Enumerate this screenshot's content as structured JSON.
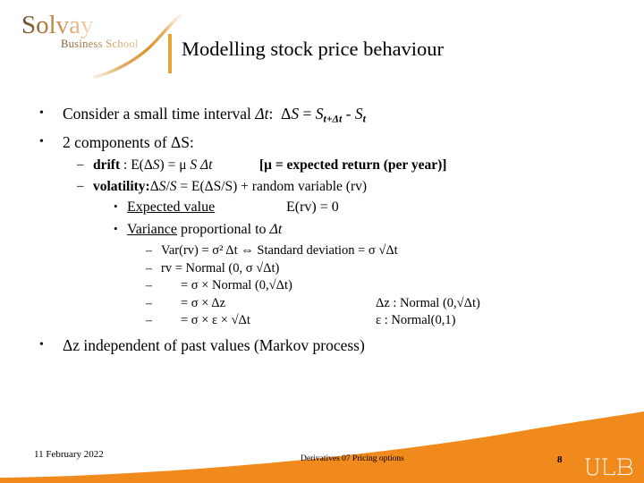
{
  "slide": {
    "logo": {
      "brand": "Solvay",
      "subtitle": "Business School",
      "swoosh_color": "#d99a3c",
      "brand_color_dark": "#6a4a2a",
      "brand_color_light": "#efd9bd"
    },
    "title": {
      "text": "Modelling stock price behaviour",
      "accent_bar_color": "#e3a730"
    },
    "accent_color": "#f08a1c",
    "body": [
      {
        "level": 1,
        "bullet": "•",
        "name": "bullet-consider-interval",
        "segments": [
          {
            "t": "Consider a small time interval "
          },
          {
            "t": "Δt",
            "style": "italic-t"
          },
          {
            "t": ":  ΔS = S"
          },
          {
            "t": "t+Δt",
            "style": "sub"
          },
          {
            "t": " - S"
          },
          {
            "t": "t",
            "style": "sub"
          }
        ],
        "plain": "Consider a small time interval Δt:  ΔS = St+Δt - St"
      },
      {
        "level": 1,
        "bullet": "•",
        "name": "bullet-two-components",
        "plain": "2 components of ΔS:"
      },
      {
        "level": 2,
        "bullet": "–",
        "name": "bullet-drift",
        "plain": "drift : E(ΔS) = μ S Δt",
        "right": "[μ = expected return (per year)]"
      },
      {
        "level": 2,
        "bullet": "–",
        "name": "bullet-volatility",
        "plain": "volatility:ΔS/S = E(ΔS/S) + random variable (rv)"
      },
      {
        "level": 3,
        "bullet": "•",
        "name": "bullet-expected-value",
        "label": "Expected value",
        "right": "E(rv) = 0"
      },
      {
        "level": 3,
        "bullet": "•",
        "name": "bullet-variance",
        "label": "Variance",
        "rest": " proportional to Δt"
      },
      {
        "level": 4,
        "bullet": "–",
        "name": "bullet-variance-formula",
        "plain": "Var(rv) = σ² Δt ⇔  Standard deviation  = σ √Δt"
      },
      {
        "level": 4,
        "bullet": "–",
        "name": "bullet-rv-normal",
        "plain": "rv = Normal (0, σ √Δt)"
      },
      {
        "level": 4,
        "bullet": "–",
        "name": "bullet-sigma-normal",
        "plain": "= σ × Normal (0,√Δt)"
      },
      {
        "level": 4,
        "bullet": "–",
        "name": "bullet-sigma-deltaz",
        "plain": "= σ × Δz",
        "right": "Δz : Normal (0,√Δt)"
      },
      {
        "level": 4,
        "bullet": "–",
        "name": "bullet-sigma-epsilon",
        "plain": "= σ × ε × √Δt",
        "right": "ε : Normal(0,1)"
      },
      {
        "level": 1,
        "bullet": "•",
        "name": "bullet-markov",
        "plain": "Δz independent of past values (Markov process)"
      }
    ],
    "footer": {
      "date": "11 February 2022",
      "center": "Derivatives 07 Pricing options",
      "page_number": "8",
      "ulb_logo_text": "ULB"
    }
  }
}
